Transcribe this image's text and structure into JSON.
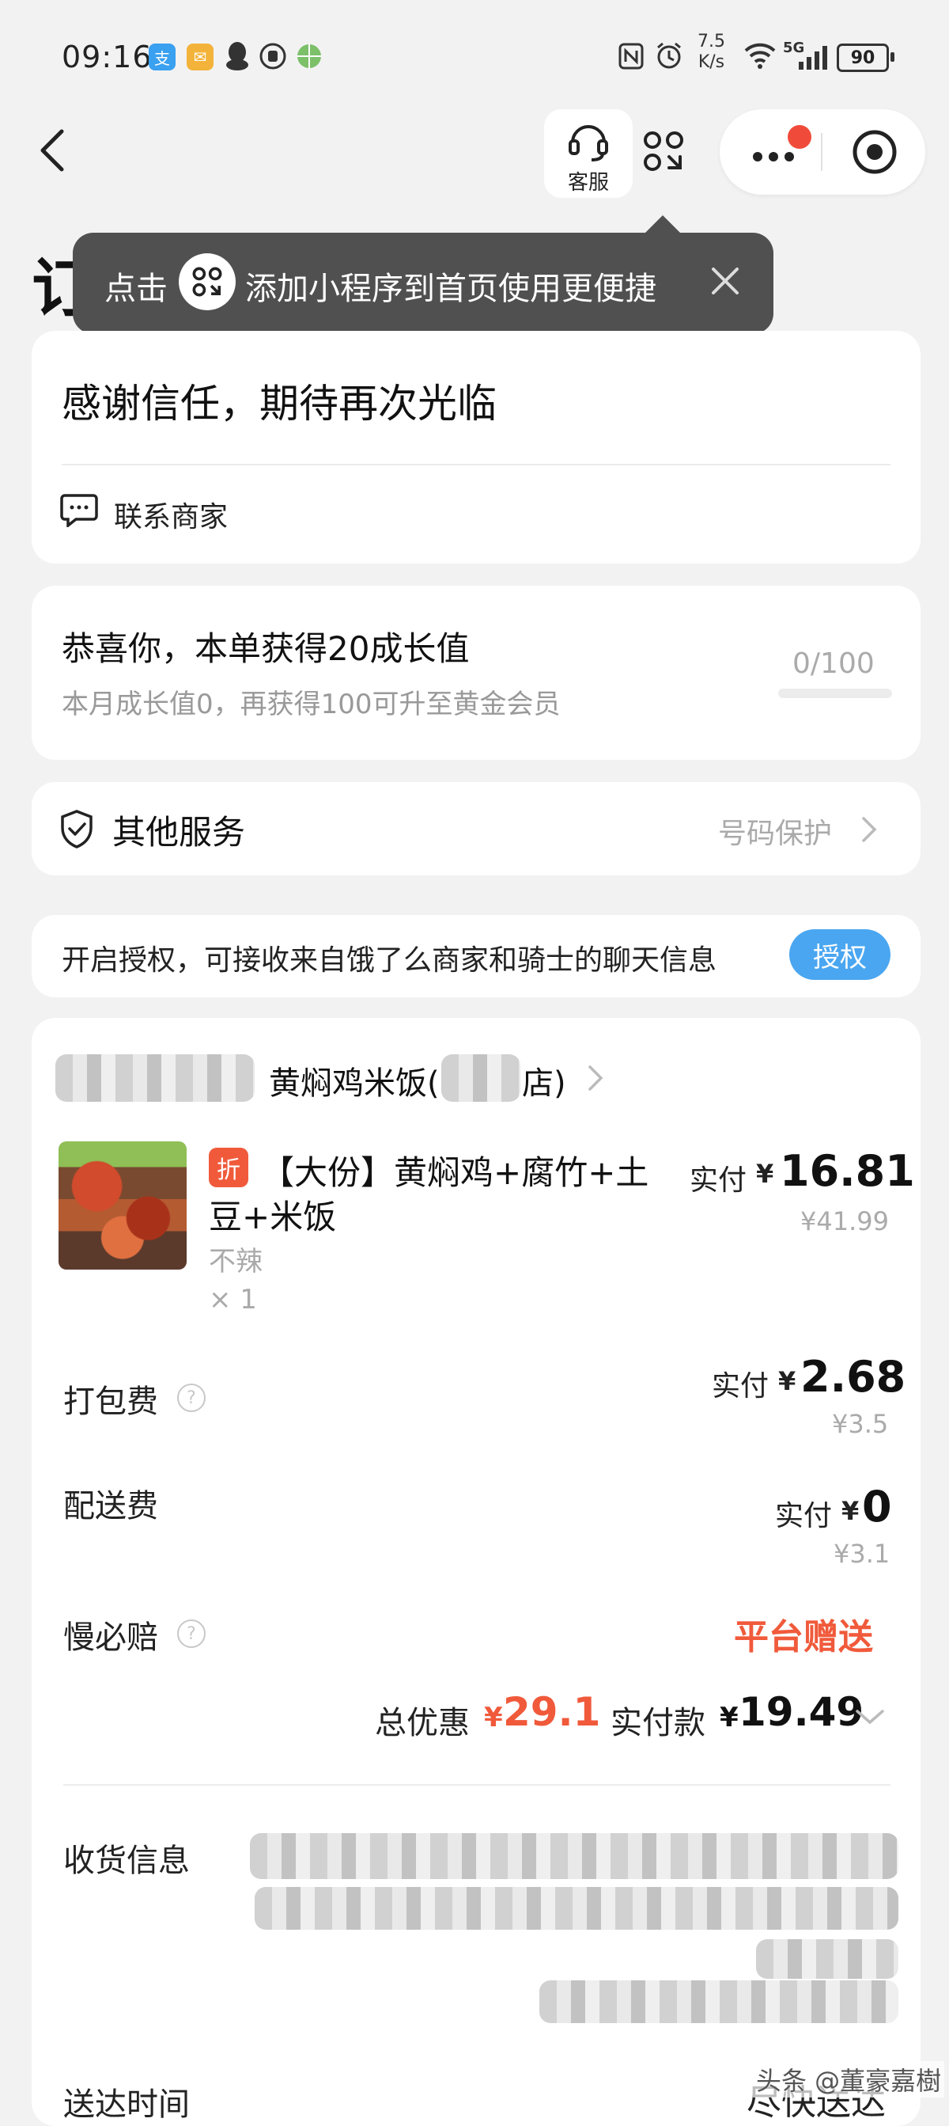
{
  "status_bar": {
    "time": "09:16",
    "net_speed_value": "7.5",
    "net_speed_unit": "K/s",
    "signal_label": "5G",
    "battery": "90",
    "app_icons": [
      "alipay-icon",
      "email-icon",
      "qq-icon",
      "hand-icon",
      "globe-icon"
    ]
  },
  "nav": {
    "customer_service_label": "客服",
    "page_title": "订"
  },
  "tooltip": {
    "text_before": "点击",
    "text_after": "添加小程序到首页使用更便捷"
  },
  "thanks_card": {
    "title": "感谢信任，期待再次光临",
    "contact_label": "联系商家"
  },
  "growth_card": {
    "title": "恭喜你，本单获得20成长值",
    "subtitle": "本月成长值0，再获得100可升至黄金会员",
    "progress_text": "0/100",
    "progress_fraction": 0
  },
  "services_card": {
    "title": "其他服务",
    "right_label": "号码保护"
  },
  "auth_card": {
    "text": "开启授权，可接收来自饿了么商家和骑士的聊天信息",
    "button_label": "授权"
  },
  "order": {
    "store_name_visible": "黄焖鸡米饭(",
    "store_name_suffix": "店)",
    "item": {
      "tag": "折",
      "name_line1": "【大份】黄焖鸡+腐竹+土",
      "name_line2": "豆+米饭",
      "spec": "不辣",
      "qty": "× 1",
      "paid_label": "实付",
      "currency": "¥",
      "paid_value": "16.81",
      "original": "¥41.99"
    },
    "packing": {
      "label": "打包费",
      "paid_label": "实付",
      "currency": "¥",
      "paid_value": "2.68",
      "original": "¥3.5"
    },
    "delivery": {
      "label": "配送费",
      "paid_label": "实付",
      "currency": "¥",
      "paid_value": "0",
      "original": "¥3.1"
    },
    "slow_comp": {
      "label": "慢必赔",
      "value": "平台赠送"
    },
    "summary": {
      "discount_label": "总优惠",
      "discount_currency": "¥",
      "discount_value": "29.1",
      "paid_label": "实付款",
      "paid_currency": "¥",
      "paid_value": "19.49"
    },
    "receiver_label": "收货信息",
    "delivery_time_label": "送达时间",
    "delivery_time_value": "尽快送达"
  },
  "watermark": "头条 @董豪嘉樹",
  "colors": {
    "accent_blue": "#4aa6f0",
    "accent_orange": "#f05a3b",
    "badge_red": "#f04b3a"
  }
}
